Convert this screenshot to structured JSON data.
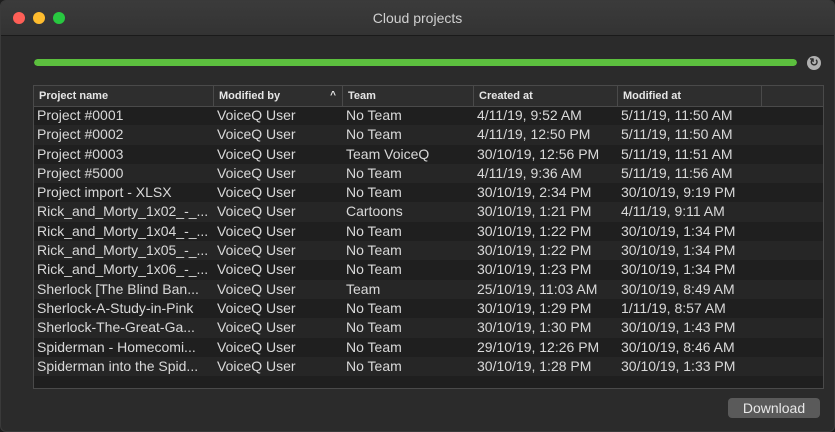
{
  "window": {
    "title": "Cloud projects"
  },
  "progress": {
    "value": 1.0,
    "color": "#5cbf3e"
  },
  "table": {
    "columns": [
      "Project name",
      "Modified by",
      "Team",
      "Created at",
      "Modified at"
    ],
    "sort_indicator": "^",
    "rows": [
      [
        "Project #0001",
        "VoiceQ User",
        "No Team",
        "4/11/19, 9:52 AM",
        "5/11/19, 11:50 AM"
      ],
      [
        "Project #0002",
        "VoiceQ User",
        "No Team",
        "4/11/19, 12:50 PM",
        "5/11/19, 11:50 AM"
      ],
      [
        "Project #0003",
        "VoiceQ User",
        "Team VoiceQ",
        "30/10/19, 12:56 PM",
        "5/11/19, 11:51 AM"
      ],
      [
        "Project #5000",
        "VoiceQ User",
        "No Team",
        "4/11/19, 9:36 AM",
        "5/11/19, 11:56 AM"
      ],
      [
        "Project import - XLSX",
        "VoiceQ User",
        "No Team",
        "30/10/19, 2:34 PM",
        "30/10/19, 9:19 PM"
      ],
      [
        "Rick_and_Morty_1x02_-_...",
        "VoiceQ User",
        "Cartoons",
        "30/10/19, 1:21 PM",
        "4/11/19, 9:11 AM"
      ],
      [
        "Rick_and_Morty_1x04_-_...",
        "VoiceQ User",
        "No Team",
        "30/10/19, 1:22 PM",
        "30/10/19, 1:34 PM"
      ],
      [
        "Rick_and_Morty_1x05_-_...",
        "VoiceQ User",
        "No Team",
        "30/10/19, 1:22 PM",
        "30/10/19, 1:34 PM"
      ],
      [
        "Rick_and_Morty_1x06_-_...",
        "VoiceQ User",
        "No Team",
        "30/10/19, 1:23 PM",
        "30/10/19, 1:34 PM"
      ],
      [
        "Sherlock [The Blind Ban...",
        "VoiceQ User",
        "Team",
        "25/10/19, 11:03 AM",
        "30/10/19, 8:49 AM"
      ],
      [
        "Sherlock-A-Study-in-Pink",
        "VoiceQ User",
        "No Team",
        "30/10/19, 1:29 PM",
        "1/11/19, 8:57 AM"
      ],
      [
        "Sherlock-The-Great-Ga...",
        "VoiceQ User",
        "No Team",
        "30/10/19, 1:30 PM",
        "30/10/19, 1:43 PM"
      ],
      [
        "Spiderman - Homecomi...",
        "VoiceQ User",
        "No Team",
        "29/10/19, 12:26 PM",
        "30/10/19, 8:46 AM"
      ],
      [
        "Spiderman into the Spid...",
        "VoiceQ User",
        "No Team",
        "30/10/19, 1:28 PM",
        "30/10/19, 1:33 PM"
      ]
    ]
  },
  "buttons": {
    "download": "Download"
  },
  "icons": {
    "refresh": "refresh-icon"
  }
}
